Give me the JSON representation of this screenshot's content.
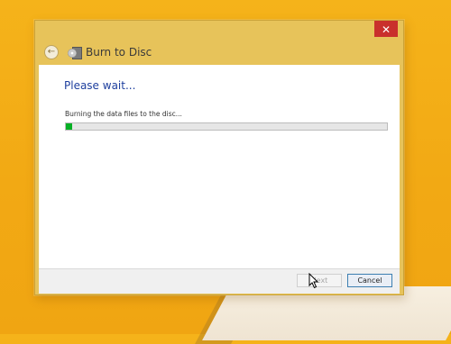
{
  "window": {
    "title": "Burn to Disc",
    "close_label": "✕"
  },
  "icons": {
    "back": "back-arrow-icon",
    "burn": "burn-to-disc-icon",
    "cursor": "mouse-pointer-icon"
  },
  "content": {
    "heading": "Please wait...",
    "status": "Burning the data files to the disc...",
    "progress": 0.02
  },
  "buttons": {
    "next": "Next",
    "cancel": "Cancel"
  },
  "colors": {
    "desktop": "#f2a914",
    "window_frame": "#e7c35a",
    "heading": "#1e3f9e",
    "progress_fill": "#06b025",
    "close_button": "#c9302c"
  }
}
